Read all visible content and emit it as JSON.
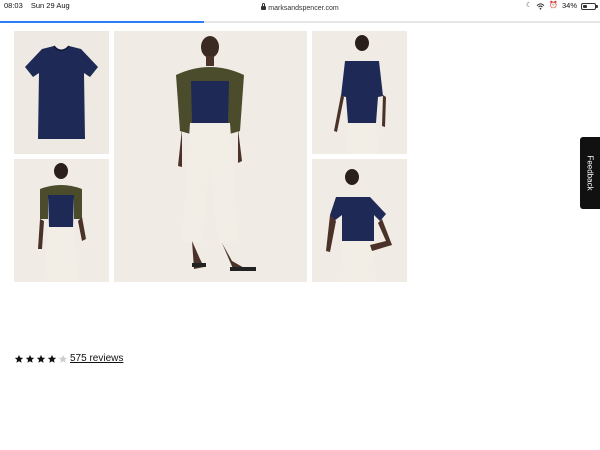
{
  "status_bar": {
    "time": "08:03",
    "date": "Sun 29 Aug",
    "url": "marksandspencer.com",
    "battery_text": "34%",
    "battery_level": 0.34
  },
  "page_load_progress": 0.34,
  "gallery": {
    "images": [
      {
        "name": "shirt-flatlay",
        "shirt_color": "#1e2a55",
        "background": "#efe9e3"
      },
      {
        "name": "model-main",
        "shirt_color": "#1e2a55",
        "trouser_color": "#f2eee6",
        "cardigan_color": "#4a4c2c"
      },
      {
        "name": "model-back"
      },
      {
        "name": "model-with-cardigan"
      },
      {
        "name": "model-front"
      }
    ]
  },
  "feedback": {
    "label": "Feedback"
  },
  "rating": {
    "stars": 4,
    "max": 5,
    "reviews_label": "575 reviews"
  },
  "colors": {
    "accent": "#2d7ff9",
    "text": "#111111",
    "star_empty": "#cfcfcf"
  }
}
